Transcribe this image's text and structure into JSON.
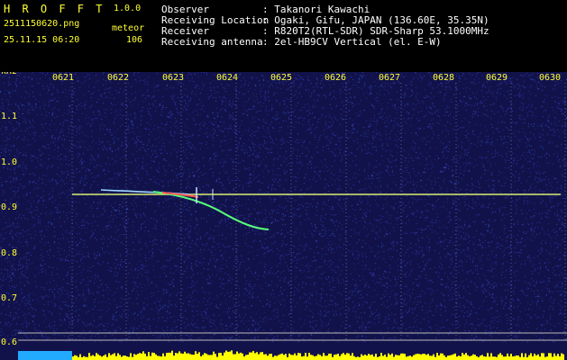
{
  "header": {
    "app_title": "H R O F F T",
    "version": "1.0.0",
    "filename": "2511150620.png",
    "label": "meteor",
    "datetime": "25.11.15 06:20",
    "count": "106",
    "info": [
      {
        "key": "Observer",
        "value": ": Takanori Kawachi"
      },
      {
        "key": "Receiving Location",
        "value": ": Ogaki, Gifu, JAPAN (136.60E, 35.35N)"
      },
      {
        "key": "Receiver",
        "value": ": R820T2(RTL-SDR) SDR-Sharp 53.1000MHz"
      },
      {
        "key": "Receiving antenna",
        "value": ": 2el-HB9CV Vertical (el. E-W)"
      }
    ]
  },
  "plot": {
    "y_unit": "kHz",
    "time_ticks": [
      "0621",
      "0622",
      "0623",
      "0624",
      "0625",
      "0626",
      "0627",
      "0628",
      "0629",
      "0630"
    ],
    "freq_ticks": [
      "1.1",
      "1.0",
      "0.9",
      "0.8",
      "0.7",
      "0.6"
    ],
    "colors": {
      "background": "#12124a",
      "carrier": "#d8f070",
      "spectrum": "#ffff00",
      "text": "#ffff33"
    }
  }
}
